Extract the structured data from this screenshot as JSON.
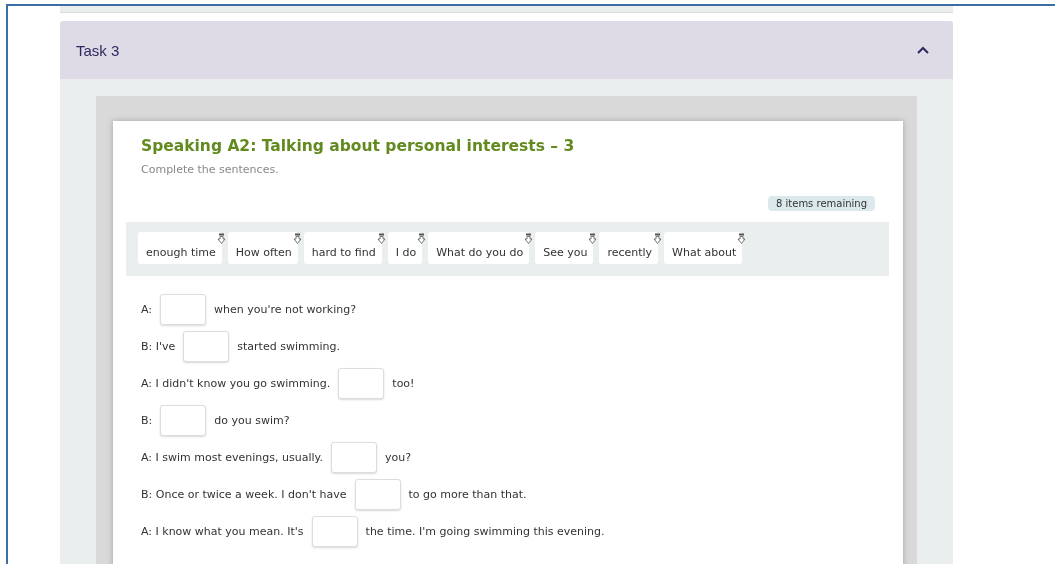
{
  "accordion": {
    "title": "Task 3",
    "expanded": true
  },
  "exercise": {
    "title": "Speaking A2: Talking about personal interests – 3",
    "instruction": "Complete the sentences.",
    "remaining": "8 items remaining",
    "chips": [
      "enough time",
      "How often",
      "hard to find",
      "I do",
      "What do you do",
      "See you",
      "recently",
      "What about"
    ],
    "lines": [
      {
        "before": "A:",
        "after": "when you're not working?"
      },
      {
        "before": "B: I've",
        "after": "started swimming."
      },
      {
        "before": "A: I didn't know you go swimming.",
        "after": "too!"
      },
      {
        "before": "B:",
        "after": "do you swim?"
      },
      {
        "before": "A: I swim most evenings, usually.",
        "after": "you?"
      },
      {
        "before": "B: Once or twice a week. I don't have",
        "after": "to go more than that."
      },
      {
        "before": "A: I know what you mean. It's",
        "after": "the time. I'm going swimming this evening."
      }
    ]
  }
}
